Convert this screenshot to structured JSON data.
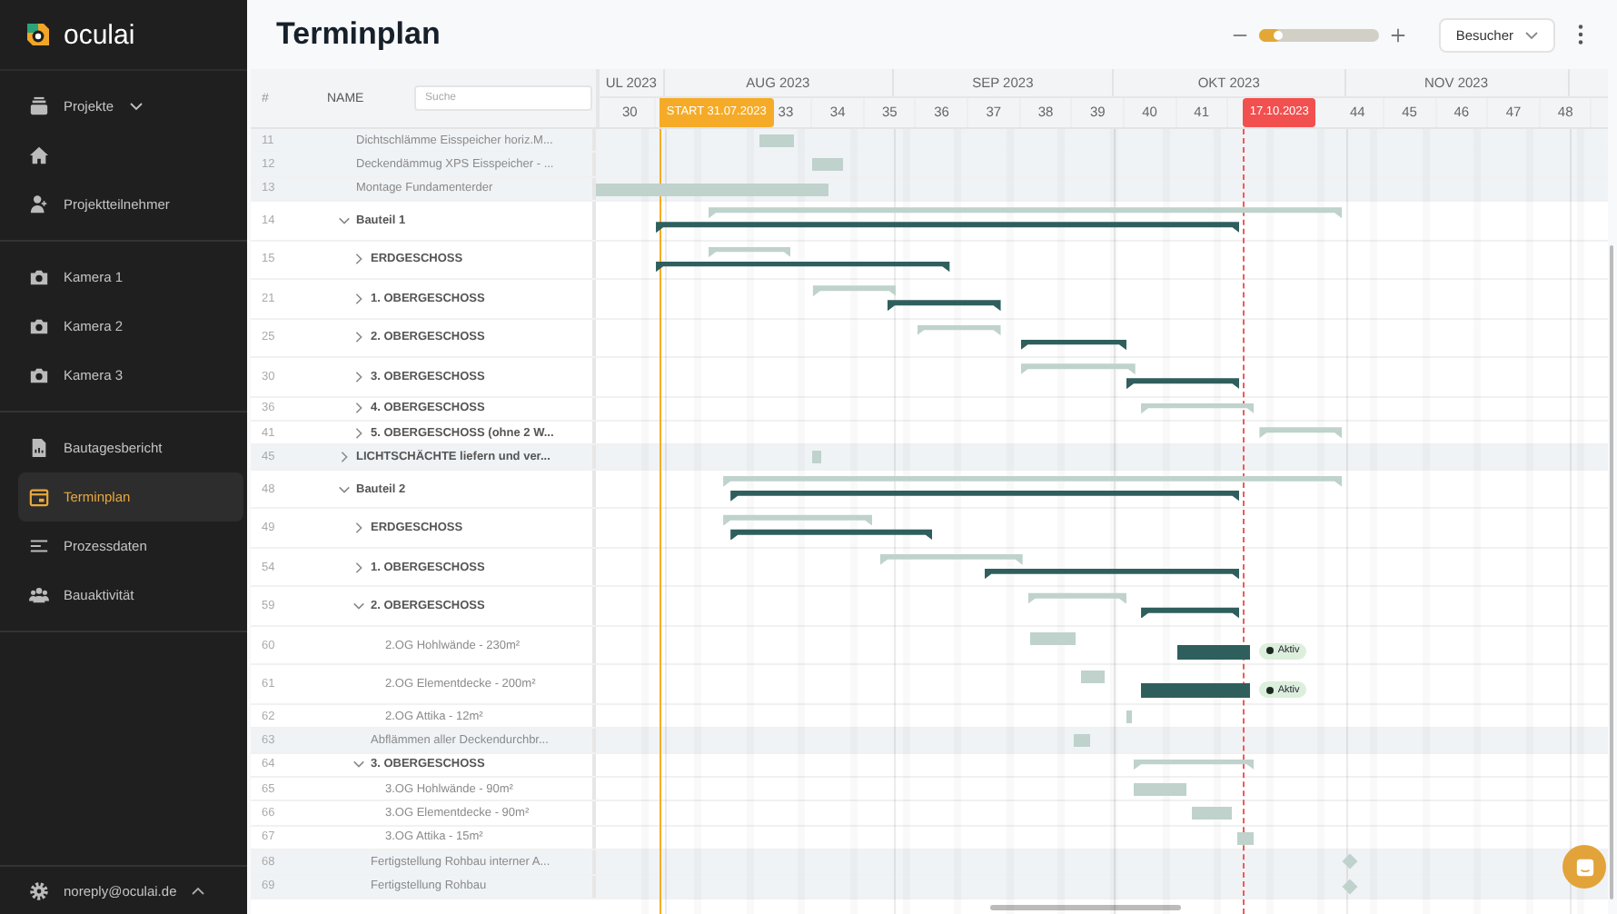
{
  "sidebar": {
    "logo": "oculai",
    "groups": [
      [
        {
          "label": "Projekte",
          "selected": false,
          "dropdown": true
        },
        {
          "selected": false
        },
        {
          "label": "Projektteilnehmer",
          "selected": false
        }
      ],
      [
        {
          "label": "Kamera 1",
          "selected": false
        },
        {
          "label": "Kamera 2",
          "selected": false
        },
        {
          "label": "Kamera 3",
          "selected": false
        }
      ],
      [
        {
          "label": "Bautagesbericht",
          "selected": false
        },
        {
          "label": "Terminplan",
          "selected": true
        },
        {
          "label": "Prozessdaten",
          "selected": false
        },
        {
          "label": "Bauaktivität",
          "selected": false
        }
      ]
    ],
    "user": "noreply@oculai.de"
  },
  "header": {
    "title": "Terminplan",
    "zoom": {
      "level": 0.18
    },
    "role_select": "Besucher"
  },
  "table": {
    "columns": [
      "#",
      "NAME"
    ],
    "search": {
      "placeholder": "Suche"
    }
  },
  "gantt": {
    "months": [
      "UL 2023",
      "AUG 2023",
      "SEP 2023",
      "OKT 2023",
      "NOV 2023"
    ],
    "weeks": [
      "30",
      "33",
      "34",
      "35",
      "36",
      "37",
      "38",
      "39",
      "40",
      "41",
      "44",
      "45",
      "46",
      "47",
      "48"
    ],
    "markers": [
      {
        "kind": "start",
        "label": "START 31.07.2023"
      },
      {
        "kind": "today",
        "label": "17.10.2023"
      }
    ],
    "rows": [
      {
        "num": "11",
        "name": "Dichtschlämme Eisspeicher horiz.M...",
        "kind": "task",
        "shaded": true
      },
      {
        "num": "12",
        "name": "Deckendämmug XPS Eisspeicher - ...",
        "kind": "task",
        "shaded": true
      },
      {
        "num": "13",
        "name": "Montage Fundamenterder",
        "kind": "task",
        "shaded": true
      },
      {
        "num": "14",
        "name": "Bauteil 1",
        "kind": "group",
        "shaded": false,
        "expanded": true,
        "children": [
          {
            "num": "15",
            "name": "ERDGESCHOSS",
            "kind": "group",
            "shaded": false,
            "expanded": false
          },
          {
            "num": "21",
            "name": "1. OBERGESCHOSS",
            "kind": "group",
            "shaded": false,
            "expanded": false
          },
          {
            "num": "25",
            "name": "2. OBERGESCHOSS",
            "kind": "group",
            "shaded": false,
            "expanded": false
          },
          {
            "num": "30",
            "name": "3. OBERGESCHOSS",
            "kind": "group",
            "shaded": false,
            "expanded": false
          },
          {
            "num": "36",
            "name": "4. OBERGESCHOSS",
            "kind": "group",
            "shaded": false,
            "expanded": false
          },
          {
            "num": "41",
            "name": "5. OBERGESCHOSS (ohne 2 W...",
            "kind": "group",
            "shaded": false,
            "expanded": false
          }
        ]
      },
      {
        "num": "45",
        "name": "LICHTSCHÄCHTE liefern und ver...",
        "kind": "group",
        "shaded": true,
        "expanded": false
      },
      {
        "num": "48",
        "name": "Bauteil 2",
        "kind": "group",
        "shaded": false,
        "expanded": true,
        "children": [
          {
            "num": "49",
            "name": "ERDGESCHOSS",
            "kind": "group",
            "shaded": false,
            "expanded": false
          },
          {
            "num": "54",
            "name": "1. OBERGESCHOSS",
            "kind": "group",
            "shaded": false,
            "expanded": false
          },
          {
            "num": "59",
            "name": "2. OBERGESCHOSS",
            "kind": "group",
            "shaded": false,
            "expanded": true,
            "children": [
              {
                "num": "60",
                "name": "2.OG Hohlwände - 230m²",
                "kind": "task",
                "shaded": false,
                "status": "Aktiv"
              },
              {
                "num": "61",
                "name": "2.OG Elementdecke - 200m²",
                "kind": "task",
                "shaded": false,
                "status": "Aktiv"
              },
              {
                "num": "62",
                "name": "2.OG Attika - 12m²",
                "kind": "task",
                "shaded": false
              }
            ]
          },
          {
            "num": "63",
            "name": "Abflämmen aller Deckendurchbr...",
            "kind": "task",
            "shaded": true
          },
          {
            "num": "64",
            "name": "3. OBERGESCHOSS",
            "kind": "group",
            "shaded": false,
            "expanded": true,
            "children": [
              {
                "num": "65",
                "name": "3.OG Hohlwände - 90m²",
                "kind": "task",
                "shaded": false
              },
              {
                "num": "66",
                "name": "3.OG Elementdecke - 90m²",
                "kind": "task",
                "shaded": false
              },
              {
                "num": "67",
                "name": "3.OG Attika - 15m²",
                "kind": "task",
                "shaded": false
              }
            ]
          },
          {
            "num": "68",
            "name": "Fertigstellung Rohbau interner A...",
            "kind": "milestone",
            "shaded": true
          },
          {
            "num": "69",
            "name": "Fertigstellung Rohbau",
            "kind": "milestone",
            "shaded": true
          }
        ]
      }
    ]
  }
}
